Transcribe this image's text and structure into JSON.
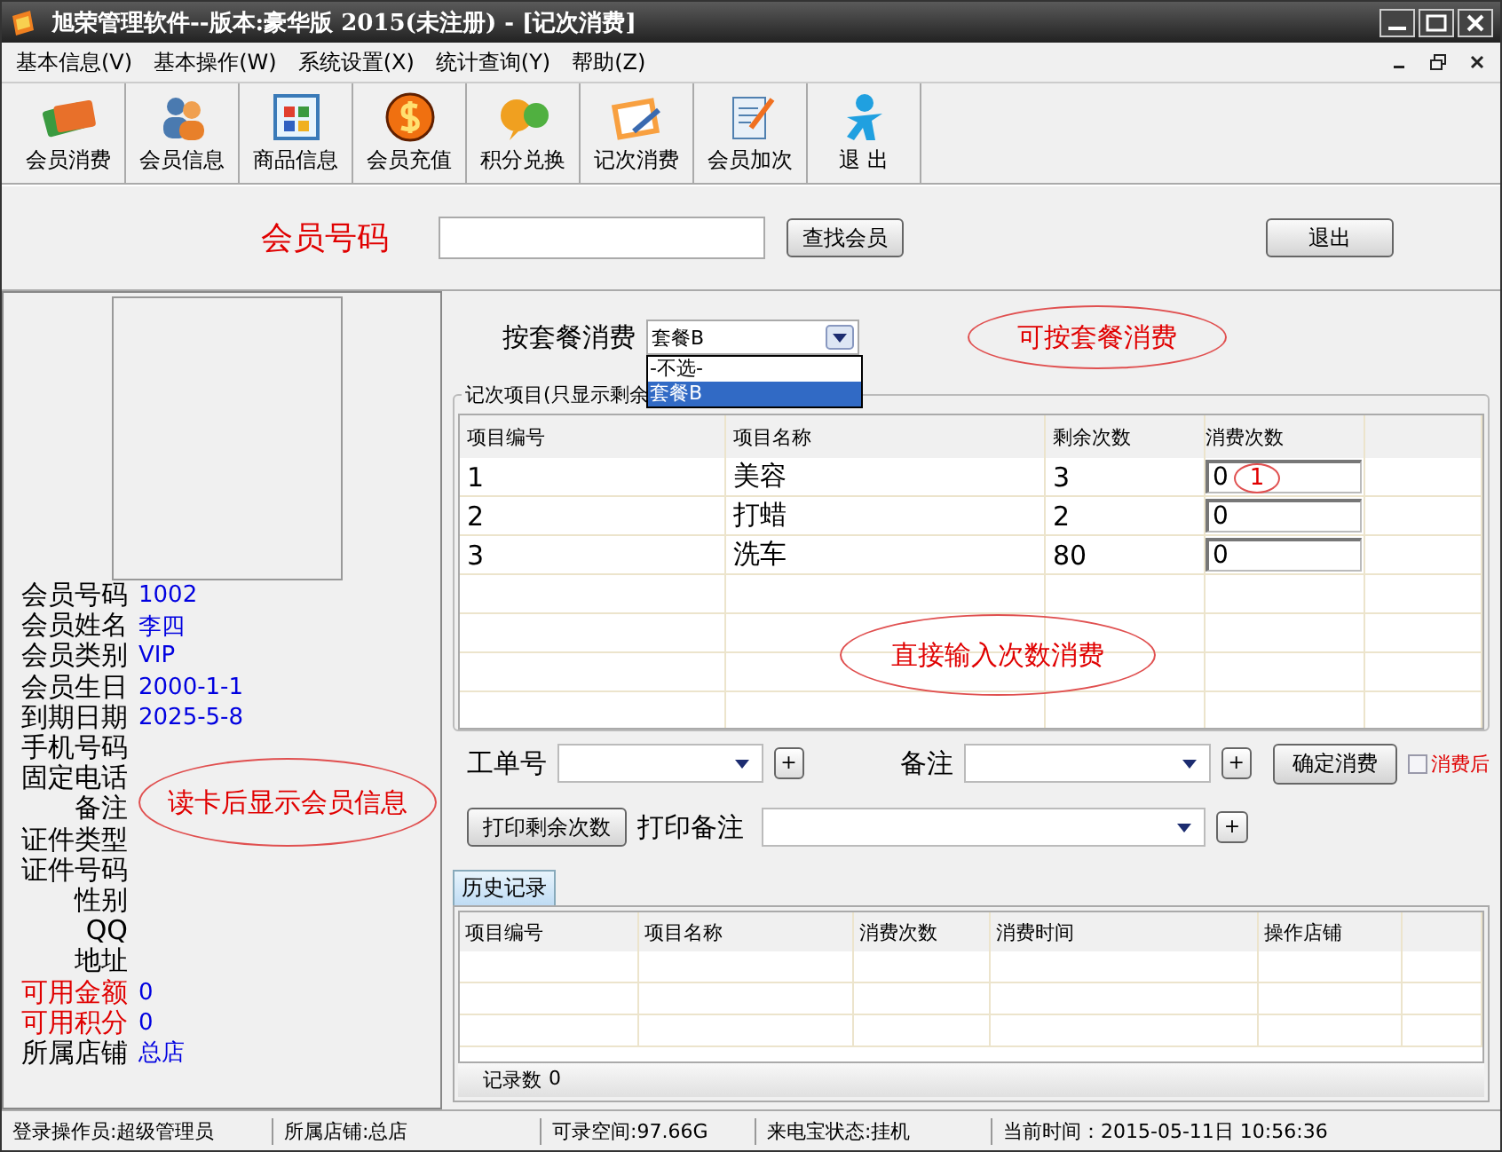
{
  "window": {
    "title": "旭荣管理软件--版本:豪华版 2015(未注册) - [记次消费]"
  },
  "menu": [
    "基本信息(V)",
    "基本操作(W)",
    "系统设置(X)",
    "统计查询(Y)",
    "帮助(Z)"
  ],
  "toolbar": [
    "会员消费",
    "会员信息",
    "商品信息",
    "会员充值",
    "积分兑换",
    "记次消费",
    "会员加次",
    "退 出"
  ],
  "search": {
    "label": "会员号码",
    "button": "查找会员",
    "exit_button": "退出"
  },
  "member_fields": [
    {
      "label": "会员号码",
      "value": "1002",
      "kind": "normal"
    },
    {
      "label": "会员姓名",
      "value": "李四",
      "kind": "normal"
    },
    {
      "label": "会员类别",
      "value": "VIP",
      "kind": "normal"
    },
    {
      "label": "会员生日",
      "value": "2000-1-1",
      "kind": "normal"
    },
    {
      "label": "到期日期",
      "value": "2025-5-8",
      "kind": "normal"
    },
    {
      "label": "手机号码",
      "kind": "normal"
    },
    {
      "label": "固定电话",
      "kind": "normal"
    },
    {
      "label": "备注",
      "kind": "normal"
    },
    {
      "label": "证件类型",
      "kind": "normal"
    },
    {
      "label": "证件号码",
      "kind": "normal"
    },
    {
      "label": "性别",
      "kind": "normal"
    },
    {
      "label": "QQ",
      "kind": "normal"
    },
    {
      "label": "地址",
      "kind": "normal"
    },
    {
      "label": "可用金额",
      "value": "0",
      "kind": "highlight"
    },
    {
      "label": "可用积分",
      "value": "0",
      "kind": "highlight"
    },
    {
      "label": "所属店铺",
      "value": "总店",
      "kind": "normal"
    }
  ],
  "package": {
    "label": "按套餐消费",
    "value": "套餐B",
    "options": [
      {
        "label": "-不选-",
        "selected": false
      },
      {
        "label": "套餐B",
        "selected": true
      }
    ]
  },
  "group_title": "记次项目(只显示剩余",
  "items_table": {
    "columns": [
      "项目编号",
      "项目名称",
      "剩余次数",
      "消费次数"
    ],
    "rows": [
      {
        "id": "1",
        "name": "美容",
        "remaining": "3",
        "consume": "0"
      },
      {
        "id": "2",
        "name": "打蜡",
        "remaining": "2",
        "consume": "0"
      },
      {
        "id": "3",
        "name": "洗车",
        "remaining": "80",
        "consume": "0"
      }
    ]
  },
  "annotations": [
    {
      "text": "读卡后显示会员信息"
    },
    {
      "text": "可按套餐消费"
    },
    {
      "text": "1"
    },
    {
      "text": "直接输入次数消费"
    }
  ],
  "form": {
    "work_order_label": "工单号",
    "remark_label": "备注",
    "plus": "+",
    "confirm_button": "确定消费",
    "after_checkbox": {
      "label": "消费后",
      "checked": false
    },
    "print_button": "打印剩余次数",
    "print_remark_label": "打印备注"
  },
  "history": {
    "tab": "历史记录",
    "columns": [
      "项目编号",
      "项目名称",
      "消费次数",
      "消费时间",
      "操作店铺"
    ],
    "count_label": "记录数",
    "count": "0"
  },
  "status_bar": [
    "登录操作员:超级管理员",
    "所属店铺:总店",
    "可录空间:97.66G",
    "来电宝状态:挂机",
    "当前时间：2015-05-11日 10:56:36"
  ]
}
